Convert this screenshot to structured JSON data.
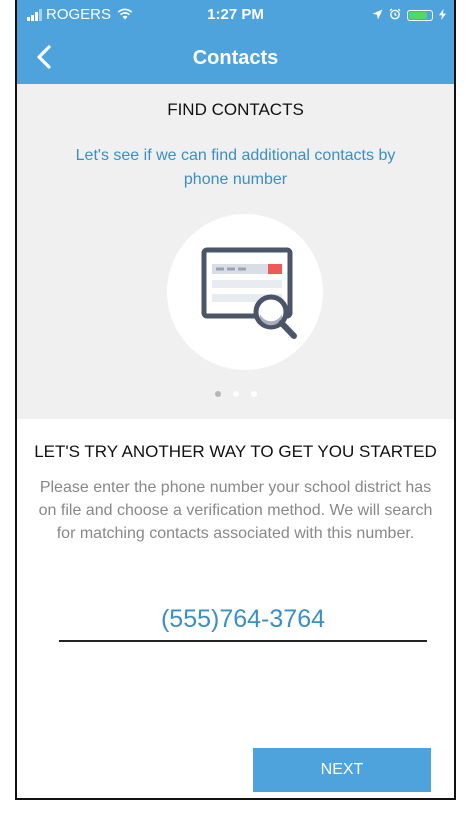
{
  "status_bar": {
    "carrier": "ROGERS",
    "time": "1:27 PM"
  },
  "nav": {
    "title": "Contacts"
  },
  "intro": {
    "heading": "FIND CONTACTS",
    "description": "Let's see if we can find additional contacts by phone number",
    "pager": {
      "count": 3,
      "active_index": 0
    }
  },
  "section": {
    "heading": "LET'S TRY ANOTHER WAY TO GET YOU STARTED",
    "description": "Please enter the phone number your school district has on file and choose a verification method. We will search for matching contacts associated with this number."
  },
  "phone": {
    "value": "(555)764-3764"
  },
  "actions": {
    "next_label": "NEXT"
  },
  "colors": {
    "accent": "#4fa3dc",
    "link_text": "#3b8fc4",
    "panel_bg": "#f0f0f0",
    "battery_green": "#4cd964",
    "search_red": "#f0595a"
  },
  "icons": {
    "back": "chevron-left-icon",
    "illustration": "browser-search-icon",
    "wifi": "wifi-icon",
    "location": "location-arrow-icon",
    "alarm": "alarm-icon",
    "battery": "battery-icon",
    "charging": "charging-bolt-icon"
  },
  "battery_level": 0.85
}
